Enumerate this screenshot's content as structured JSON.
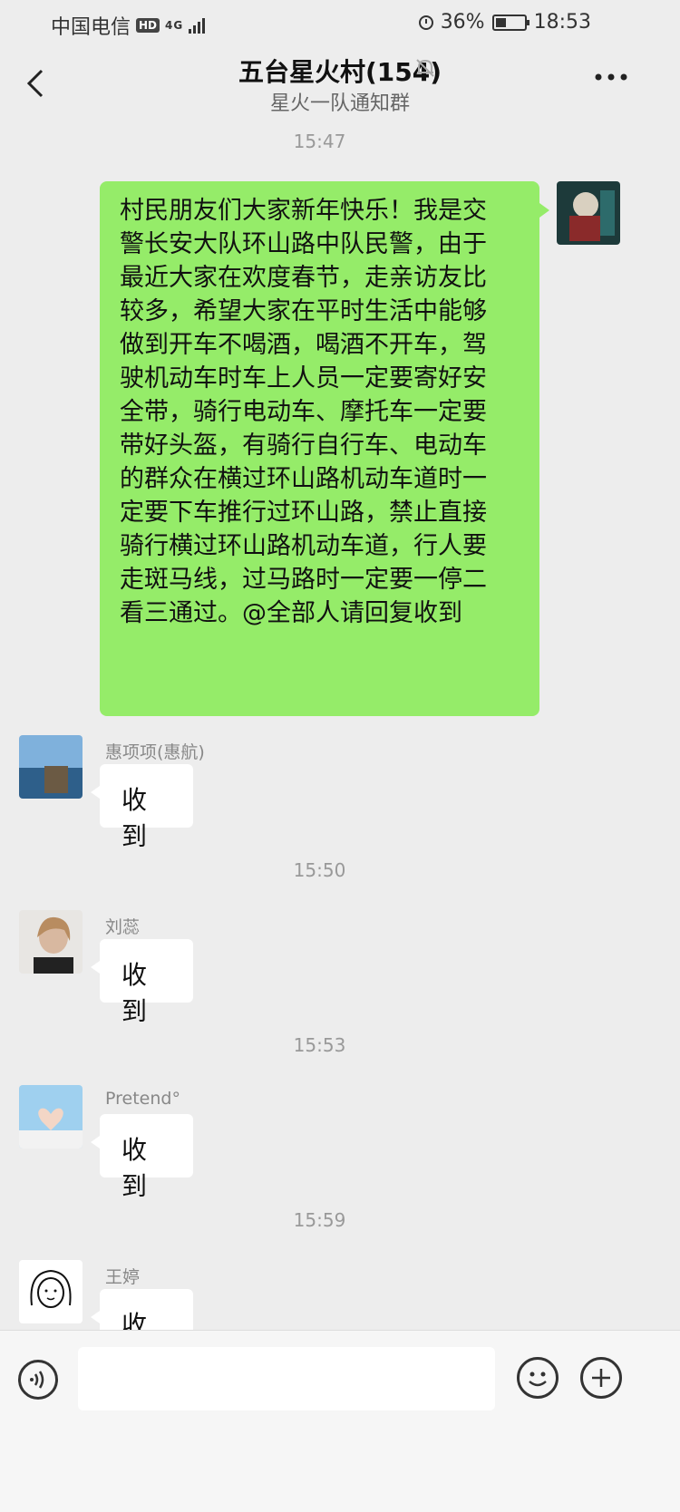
{
  "status": {
    "carrier": "中国电信",
    "hd": "HD",
    "network": "4G",
    "battery_pct": "36%",
    "battery_level": 0.36,
    "time": "18:53"
  },
  "header": {
    "title": "五台星火村(154)",
    "subtitle": "星火一队通知群"
  },
  "messages": {
    "ts1": "15:47",
    "long_lines": [
      "村民朋友们大家新年快乐！我是交",
      "警长安大队环山路中队民警，由于",
      "最近大家在欢度春节，走亲访友比",
      "较多，希望大家在平时生活中能够",
      "做到开车不喝酒，喝酒不开车，驾",
      "驶机动车时车上人员一定要寄好安",
      "全带，骑行电动车、摩托车一定要",
      "带好头盔，有骑行自行车、电动车",
      "的群众在横过环山路机动车道时一",
      "定要下车推行过环山路，禁止直接",
      "骑行横过环山路机动车道，行人要",
      "走斑马线，过马路时一定要一停二",
      "看三通过。@全部人请回复收到"
    ],
    "m1": {
      "name": "惠项项(惠航)",
      "text": "收到"
    },
    "ts2": "15:50",
    "m2": {
      "name": "刘蕊",
      "text": "收到"
    },
    "ts3": "15:53",
    "m3": {
      "name": "Pretend°",
      "text": "收到"
    },
    "ts4": "15:59",
    "m4": {
      "name": "王婷",
      "text": "收到"
    }
  },
  "colors": {
    "self_bubble": "#95ec69",
    "background": "#ededed"
  }
}
